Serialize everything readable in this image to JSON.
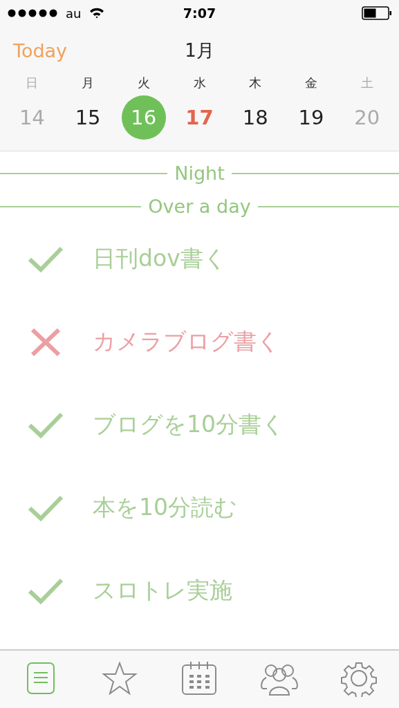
{
  "status_bar": {
    "carrier": "au",
    "time": "7:07"
  },
  "header": {
    "today_button": "Today",
    "month": "1月"
  },
  "days": [
    {
      "weekday": "日",
      "date": "14",
      "kind": "weekend"
    },
    {
      "weekday": "月",
      "date": "15",
      "kind": "weekday"
    },
    {
      "weekday": "火",
      "date": "16",
      "kind": "selected"
    },
    {
      "weekday": "水",
      "date": "17",
      "kind": "today"
    },
    {
      "weekday": "木",
      "date": "18",
      "kind": "weekday"
    },
    {
      "weekday": "金",
      "date": "19",
      "kind": "weekday"
    },
    {
      "weekday": "土",
      "date": "20",
      "kind": "weekend"
    }
  ],
  "sections": [
    {
      "title": "Night"
    },
    {
      "title": "Over a day",
      "tasks": [
        {
          "label": "日刊dov書く",
          "done": true
        },
        {
          "label": "カメラブログ書く",
          "done": false
        },
        {
          "label": "ブログを10分書く",
          "done": true
        },
        {
          "label": "本を10分読む",
          "done": true
        },
        {
          "label": "スロトレ実施",
          "done": true
        }
      ]
    }
  ],
  "tab_bar": [
    {
      "kind": "list",
      "selected": true
    },
    {
      "kind": "star",
      "selected": false
    },
    {
      "kind": "calendar",
      "selected": false
    },
    {
      "kind": "people",
      "selected": false
    },
    {
      "kind": "settings",
      "selected": false
    }
  ]
}
